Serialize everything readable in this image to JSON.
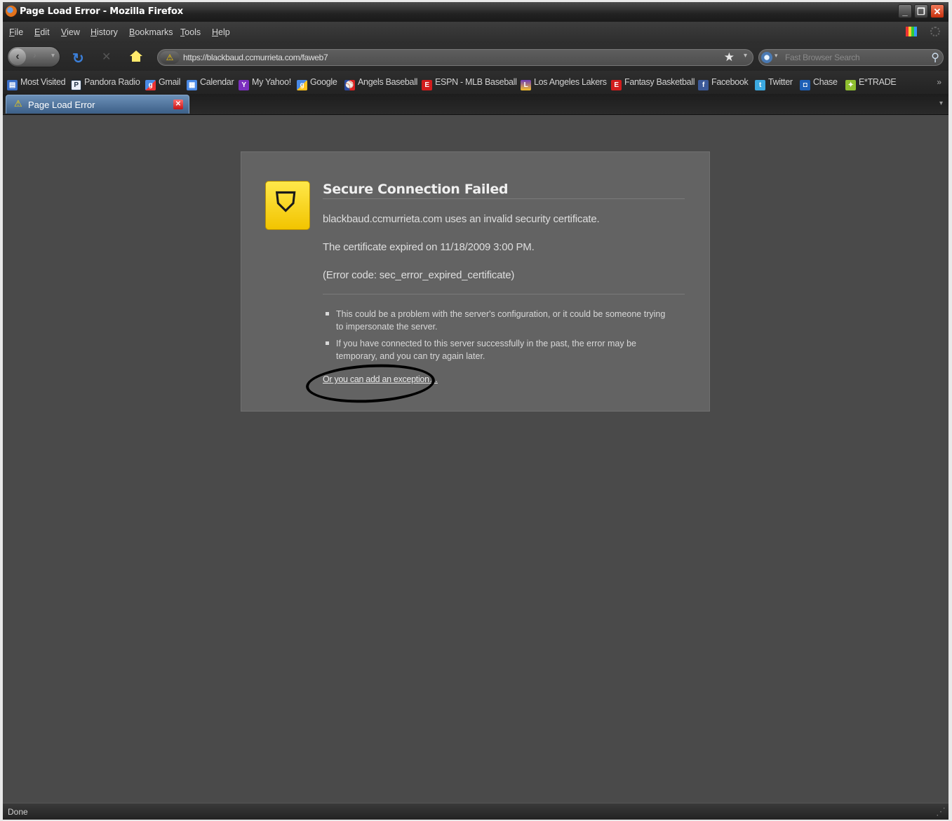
{
  "window": {
    "title": "Page Load Error - Mozilla Firefox",
    "controls": {
      "minimize": "_",
      "restore": "❐",
      "close": "✕"
    }
  },
  "menu": [
    "File",
    "Edit",
    "View",
    "History",
    "Bookmarks",
    "Tools",
    "Help"
  ],
  "nav": {
    "url": "https://blackbaud.ccmurrieta.com/faweb7",
    "search_placeholder": "Fast Browser Search"
  },
  "bookmarks": [
    {
      "label": "Most Visited",
      "icon": "most-visited-icon",
      "color": "#3a6fc8"
    },
    {
      "label": "Pandora Radio",
      "icon": "pandora-icon",
      "color": "#3a6fc8"
    },
    {
      "label": "Gmail",
      "icon": "google-icon",
      "color": "#4a8ae6"
    },
    {
      "label": "Calendar",
      "icon": "calendar-icon",
      "color": "#4a8ae6"
    },
    {
      "label": "My Yahoo!",
      "icon": "yahoo-icon",
      "color": "#7b2fbe"
    },
    {
      "label": "Google",
      "icon": "google-icon",
      "color": "#4a8ae6"
    },
    {
      "label": "Angels Baseball",
      "icon": "mlb-icon",
      "color": "#2a4aa0"
    },
    {
      "label": "ESPN - MLB Baseball",
      "icon": "espn-icon",
      "color": "#d21c1c"
    },
    {
      "label": "Los Angeles Lakers",
      "icon": "lakers-icon",
      "color": "#6c3ab8"
    },
    {
      "label": "Fantasy Basketball",
      "icon": "espn-icon",
      "color": "#d21c1c"
    },
    {
      "label": "Facebook",
      "icon": "facebook-icon",
      "color": "#3b5998"
    },
    {
      "label": "Twitter",
      "icon": "twitter-icon",
      "color": "#3ca9e0"
    },
    {
      "label": "Chase",
      "icon": "chase-icon",
      "color": "#1d5fb6"
    },
    {
      "label": "E*TRADE",
      "icon": "etrade-icon",
      "color": "#8fbf2f"
    }
  ],
  "bookmarks_more": "»",
  "tab": {
    "label": "Page Load Error"
  },
  "error": {
    "title": "Secure Connection Failed",
    "line1": "blackbaud.ccmurrieta.com uses an invalid security certificate.",
    "line2": "The certificate expired on 11/18/2009 3:00 PM.",
    "line3": "(Error code: sec_error_expired_certificate)",
    "bullets": [
      "This could be a problem with the server's configuration, or it could be someone trying to impersonate the server.",
      "If you have connected to this server successfully in the past, the error may be temporary, and you can try again later."
    ],
    "exception_link": "Or you can add an exception…"
  },
  "status": "Done"
}
